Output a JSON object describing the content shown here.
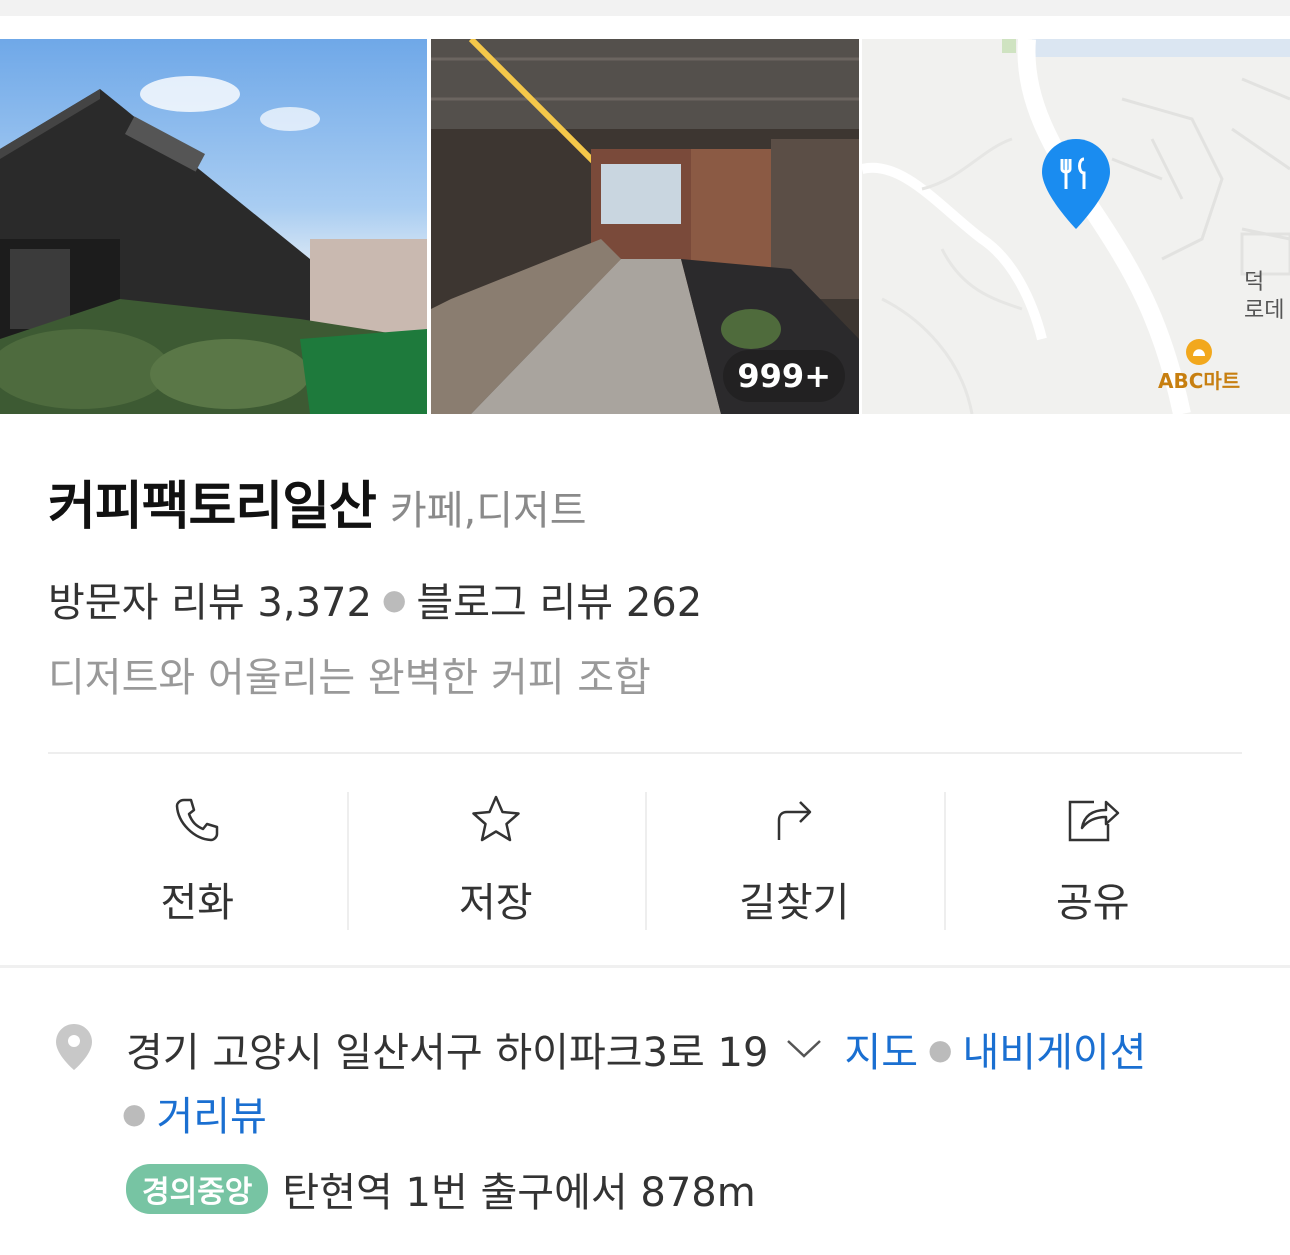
{
  "photos": {
    "count_badge": "999+",
    "map": {
      "road_label": "덕\n로데",
      "poi_label": "ABC마트"
    }
  },
  "place": {
    "name": "커피팩토리일산",
    "category": "카페,디저트",
    "visitor_review_label": "방문자 리뷰 3,372",
    "blog_review_label": "블로그 리뷰 262",
    "description": "디저트와 어울리는 완벽한 커피 조합"
  },
  "actions": [
    {
      "label": "전화",
      "icon": "phone-icon"
    },
    {
      "label": "저장",
      "icon": "star-icon"
    },
    {
      "label": "길찾기",
      "icon": "directions-icon"
    },
    {
      "label": "공유",
      "icon": "share-icon"
    }
  ],
  "address": {
    "text": "경기 고양시 일산서구 하이파크3로 19",
    "map_link": "지도",
    "navigation_link": "내비게이션",
    "streetview_link": "거리뷰"
  },
  "subway": {
    "line": "경의중앙",
    "line_color": "#77c4a3",
    "directions": "탄현역 1번 출구에서 878m"
  },
  "colors": {
    "link": "#1a6fd1",
    "map_pin": "#1a8cf0"
  }
}
